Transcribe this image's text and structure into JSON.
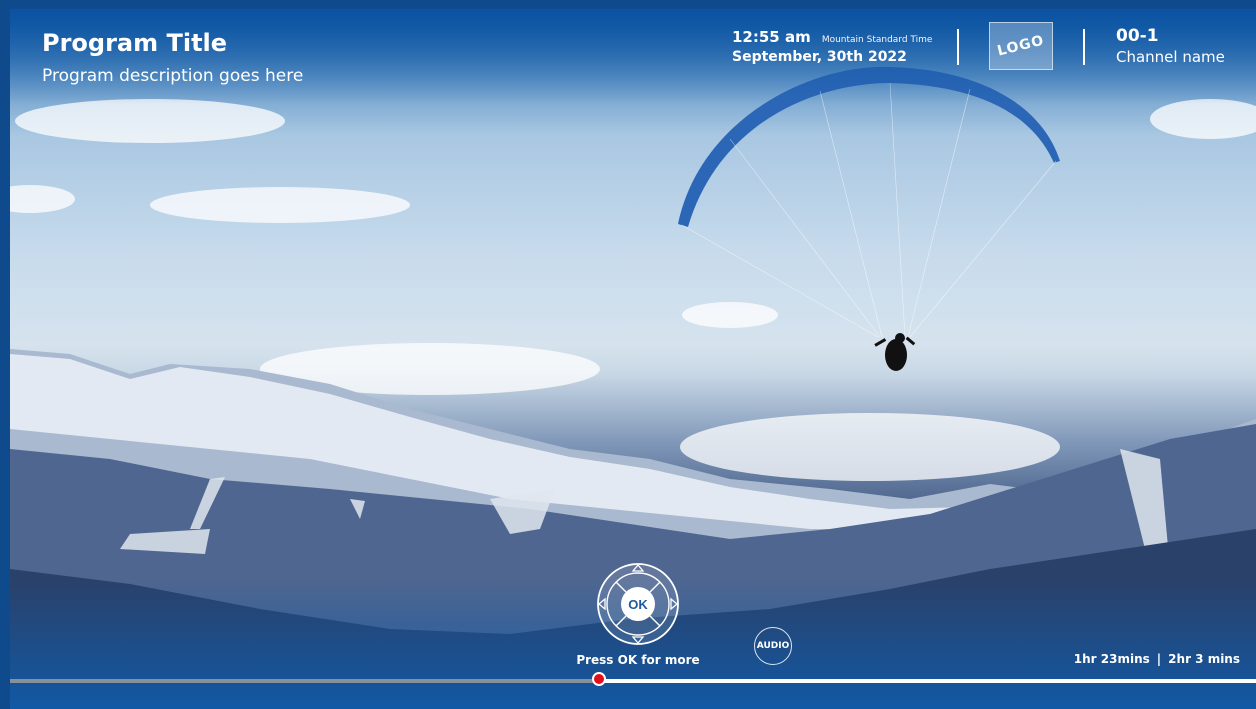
{
  "program": {
    "title": "Program Title",
    "description": "Program description goes here"
  },
  "clock": {
    "time": "12:55 am",
    "timezone": "Mountain Standard Time",
    "date": "September, 30th 2022"
  },
  "logo": {
    "text": "LOGO"
  },
  "channel": {
    "number": "00-1",
    "name": "Channel name"
  },
  "controls": {
    "ok_label": "OK",
    "press_ok_hint": "Press OK for more",
    "audio_label": "AUDIO"
  },
  "duration": {
    "elapsed": "1hr 23mins",
    "separator": "|",
    "total": "2hr 3 mins"
  },
  "progress": {
    "fraction": 0.473
  },
  "colors": {
    "overlay_blue": "#105aa8",
    "progress_knob": "#e10f1a",
    "progress_watched": "#8a9099"
  },
  "icons": [
    "ok-dpad-icon",
    "arrow-up-icon",
    "arrow-down-icon",
    "arrow-left-icon",
    "arrow-right-icon",
    "audio-icon"
  ]
}
